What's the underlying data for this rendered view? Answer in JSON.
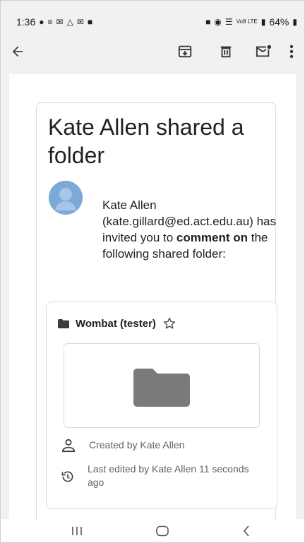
{
  "status_bar": {
    "time": "1:36",
    "battery": "64%",
    "network": "Vo8 LTE"
  },
  "app_bar": {
    "icons": [
      "back-arrow-icon",
      "archive-icon",
      "delete-icon",
      "mark-unread-icon",
      "more-vert-icon"
    ]
  },
  "email": {
    "title": "Kate Allen shared a folder",
    "sender_name": "Kate Allen",
    "sender_email": "(kate.gillard@ed.act.edu.au)",
    "invite_mid": "has invited you to",
    "permission": "comment on",
    "invite_end": "the following shared folder:",
    "folder": {
      "name": "Wombat (tester)",
      "created_by": "Created by Kate Allen",
      "last_edited": "Last edited by Kate Allen 11 seconds ago"
    }
  },
  "colors": {
    "avatar": "#7baad8",
    "folder_grey": "#7a7a7a",
    "background": "#f1f1f1"
  }
}
